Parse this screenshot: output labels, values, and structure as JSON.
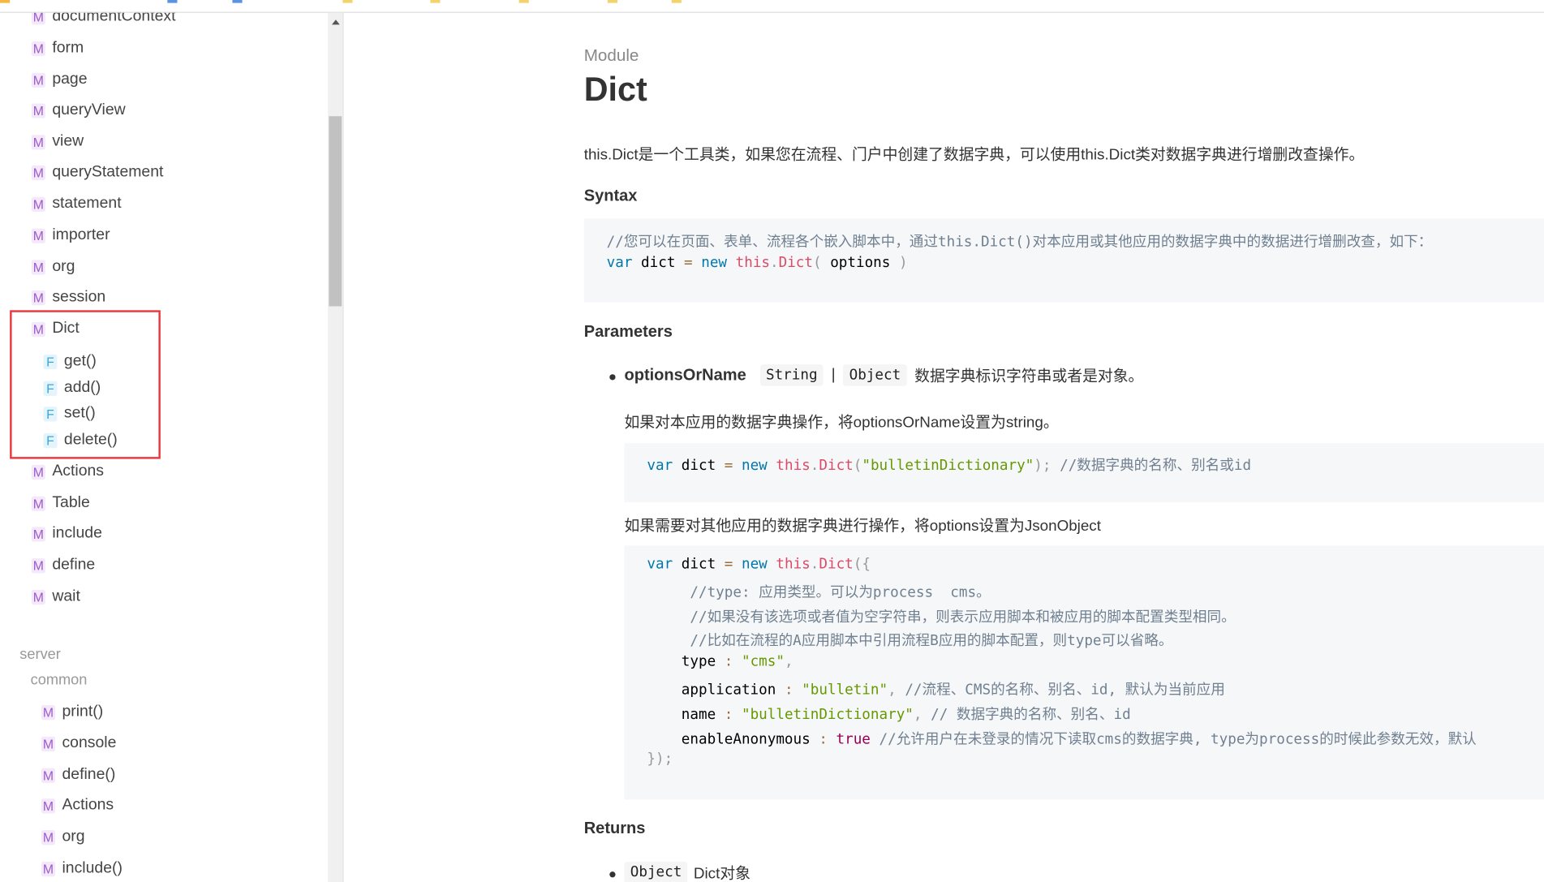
{
  "sidebar": {
    "items_top": [
      {
        "badge": "M",
        "label": "documentContext"
      },
      {
        "badge": "M",
        "label": "form"
      },
      {
        "badge": "M",
        "label": "page"
      },
      {
        "badge": "M",
        "label": "queryView"
      },
      {
        "badge": "M",
        "label": "view"
      },
      {
        "badge": "M",
        "label": "queryStatement"
      },
      {
        "badge": "M",
        "label": "statement"
      },
      {
        "badge": "M",
        "label": "importer"
      },
      {
        "badge": "M",
        "label": "org"
      },
      {
        "badge": "M",
        "label": "session"
      },
      {
        "badge": "M",
        "label": "Dict"
      }
    ],
    "dict_functions": [
      {
        "badge": "F",
        "label": "get()"
      },
      {
        "badge": "F",
        "label": "add()"
      },
      {
        "badge": "F",
        "label": "set()"
      },
      {
        "badge": "F",
        "label": "delete()"
      }
    ],
    "items_after": [
      {
        "badge": "M",
        "label": "Actions"
      },
      {
        "badge": "M",
        "label": "Table"
      },
      {
        "badge": "M",
        "label": "include"
      },
      {
        "badge": "M",
        "label": "define"
      },
      {
        "badge": "M",
        "label": "wait"
      }
    ],
    "group_server": "server",
    "group_common": "common",
    "common_items": [
      {
        "badge": "M",
        "label": "print()"
      },
      {
        "badge": "M",
        "label": "console"
      },
      {
        "badge": "M",
        "label": "define()"
      },
      {
        "badge": "M",
        "label": "Actions"
      },
      {
        "badge": "M",
        "label": "org"
      },
      {
        "badge": "M",
        "label": "include()"
      }
    ]
  },
  "content": {
    "kicker": "Module",
    "title": "Dict",
    "intro": "this.Dict是一个工具类，如果您在流程、门户中创建了数据字典，可以使用this.Dict类对数据字典进行增删改查操作。",
    "syntax_heading": "Syntax",
    "syntax_code": [
      [
        [
          "cm",
          "//您可以在页面、表单、流程各个嵌入脚本中，通过this.Dict()对本应用或其他应用的数据字典中的数据进行增删改查，如下："
        ]
      ],
      [
        [
          "kw",
          "var"
        ],
        [
          "pl",
          " dict "
        ],
        [
          "op",
          "="
        ],
        [
          "pl",
          " "
        ],
        [
          "kw",
          "new"
        ],
        [
          "pl",
          " "
        ],
        [
          "fn",
          "this"
        ],
        [
          "pu",
          "."
        ],
        [
          "fn",
          "Dict"
        ],
        [
          "pu",
          "("
        ],
        [
          "pl",
          " options "
        ],
        [
          "pu",
          ")"
        ]
      ]
    ],
    "parameters_heading": "Parameters",
    "param": {
      "name": "optionsOrName",
      "type1": "String",
      "separator": "|",
      "type2": "Object",
      "desc": "数据字典标识字符串或者是对象。"
    },
    "para_string": "如果对本应用的数据字典操作，将optionsOrName设置为string。",
    "code_string": [
      [
        [
          "kw",
          "var"
        ],
        [
          "pl",
          " dict "
        ],
        [
          "op",
          "="
        ],
        [
          "pl",
          " "
        ],
        [
          "kw",
          "new"
        ],
        [
          "pl",
          " "
        ],
        [
          "fn",
          "this"
        ],
        [
          "pu",
          "."
        ],
        [
          "fn",
          "Dict"
        ],
        [
          "pu",
          "("
        ],
        [
          "st",
          "\"bulletinDictionary\""
        ],
        [
          "pu",
          ");"
        ],
        [
          "pl",
          " "
        ],
        [
          "cm",
          "//数据字典的名称、别名或id"
        ]
      ]
    ],
    "para_object": "如果需要对其他应用的数据字典进行操作，将options设置为JsonObject",
    "code_object": [
      [
        [
          "kw",
          "var"
        ],
        [
          "pl",
          " dict "
        ],
        [
          "op",
          "="
        ],
        [
          "pl",
          " "
        ],
        [
          "kw",
          "new"
        ],
        [
          "pl",
          " "
        ],
        [
          "fn",
          "this"
        ],
        [
          "pu",
          "."
        ],
        [
          "fn",
          "Dict"
        ],
        [
          "pu",
          "({"
        ]
      ],
      [
        [
          "cm",
          "     //type: 应用类型。可以为process  cms。"
        ]
      ],
      [
        [
          "cm",
          "     //如果没有该选项或者值为空字符串，则表示应用脚本和被应用的脚本配置类型相同。"
        ]
      ],
      [
        [
          "cm",
          "     //比如在流程的A应用脚本中引用流程B应用的脚本配置，则type可以省略。"
        ]
      ],
      [
        [
          "pl",
          "    type "
        ],
        [
          "op",
          ":"
        ],
        [
          "pl",
          " "
        ],
        [
          "st",
          "\"cms\""
        ],
        [
          "pu",
          ","
        ]
      ],
      [
        [
          "pl",
          "    application "
        ],
        [
          "op",
          ":"
        ],
        [
          "pl",
          " "
        ],
        [
          "st",
          "\"bulletin\""
        ],
        [
          "pu",
          ","
        ],
        [
          "pl",
          " "
        ],
        [
          "cm",
          "//流程、CMS的名称、别名、id, 默认为当前应用"
        ]
      ],
      [
        [
          "pl",
          "    name "
        ],
        [
          "op",
          ":"
        ],
        [
          "pl",
          " "
        ],
        [
          "st",
          "\"bulletinDictionary\""
        ],
        [
          "pu",
          ","
        ],
        [
          "pl",
          " "
        ],
        [
          "cm",
          "// 数据字典的名称、别名、id"
        ]
      ],
      [
        [
          "pl",
          "    enableAnonymous "
        ],
        [
          "op",
          ":"
        ],
        [
          "pl",
          " "
        ],
        [
          "bo",
          "true"
        ],
        [
          "pl",
          " "
        ],
        [
          "cm",
          "//允许用户在未登录的情况下读取cms的数据字典, type为process的时候此参数无效，默认"
        ]
      ],
      [
        [
          "pu",
          "});"
        ]
      ]
    ],
    "returns_heading": "Returns",
    "returns": {
      "type": "Object",
      "desc": "Dict对象"
    }
  },
  "colors": {
    "accent_red": "#e8373d",
    "module_badge": "#9c5ac9",
    "function_badge": "#3ba7d9"
  }
}
